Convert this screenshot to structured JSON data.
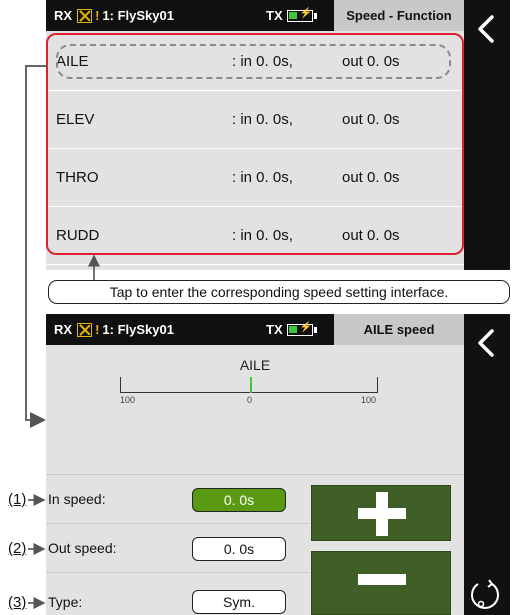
{
  "screen1": {
    "status": {
      "rx_label": "RX",
      "model": "1: FlySky01",
      "tx_label": "TX",
      "function_title": "Speed - Function",
      "tx_battery_level": 0.3
    },
    "rows": [
      {
        "name": "AILE",
        "in": ": in  0. 0s,",
        "out": "out  0. 0s"
      },
      {
        "name": "ELEV",
        "in": ": in  0. 0s,",
        "out": "out  0. 0s"
      },
      {
        "name": "THRO",
        "in": ": in  0. 0s,",
        "out": "out  0. 0s"
      },
      {
        "name": "RUDD",
        "in": ": in  0. 0s,",
        "out": "out  0. 0s"
      }
    ]
  },
  "caption": "Tap to enter the corresponding speed setting interface.",
  "screen2": {
    "status": {
      "rx_label": "RX",
      "model": "1: FlySky01",
      "tx_label": "TX",
      "function_title": "AILE  speed"
    },
    "gauge": {
      "title": "AILE",
      "left_label": "100",
      "center_label": "0",
      "right_label": "100",
      "position": 0
    },
    "settings": {
      "in_label": "In speed:",
      "in_value": "0. 0s",
      "out_label": "Out speed:",
      "out_value": "0. 0s",
      "type_label": "Type:",
      "type_value": "Sym."
    }
  },
  "annotations": [
    "(1)",
    "(2)",
    "(3)"
  ],
  "colors": {
    "red_frame": "#e02030",
    "accent_green": "#5a9a13",
    "button_green": "#3f5f27",
    "warning": "#e4b400"
  },
  "icons": [
    "x-box-icon",
    "warning-icon",
    "battery-icon",
    "back-chevron-icon",
    "return-icon",
    "plus-icon",
    "minus-icon"
  ]
}
